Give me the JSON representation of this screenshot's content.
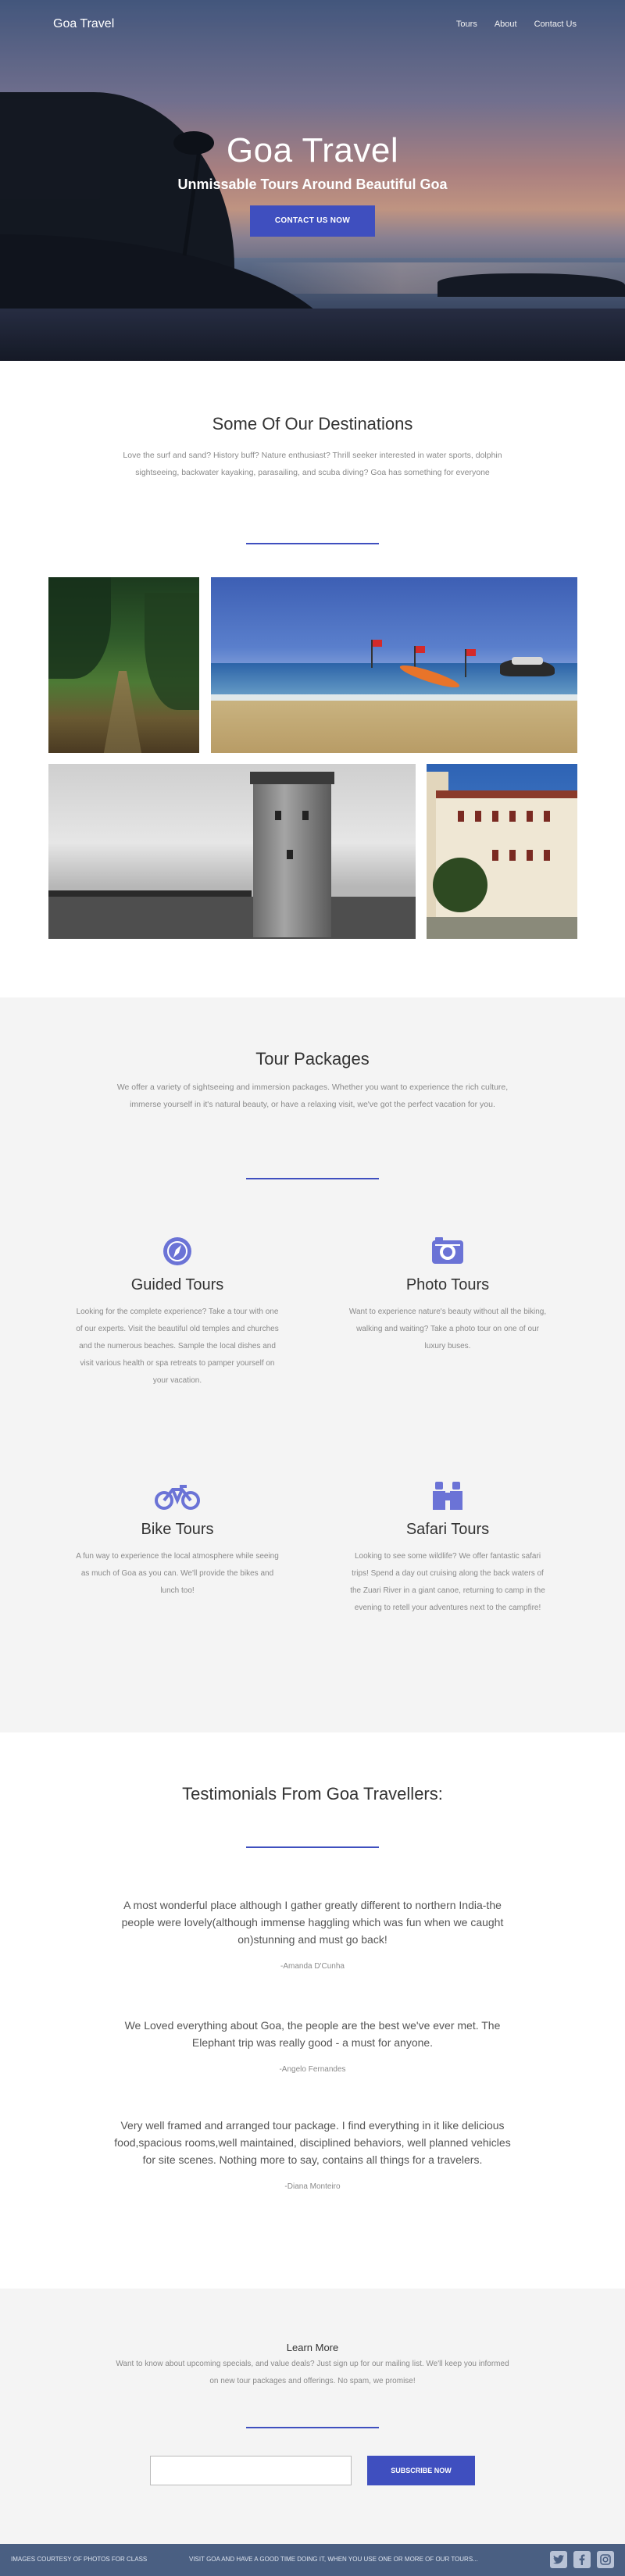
{
  "colors": {
    "accent": "#3f4fbf",
    "icon": "#6b73d6",
    "footer_bg": "#4a5f82",
    "section_alt_bg": "#f4f4f4"
  },
  "nav": {
    "brand": "Goa Travel",
    "links": [
      "Tours",
      "About",
      "Contact Us"
    ]
  },
  "hero": {
    "title": "Goa Travel",
    "subtitle": "Unmissable Tours Around Beautiful Goa",
    "cta": "CONTACT US NOW"
  },
  "destinations": {
    "title": "Some Of Our Destinations",
    "text": "Love the surf and sand? History buff? Nature enthusiast? Thrill seeker interested in water sports, dolphin sightseeing, backwater kayaking, parasailing, and scuba diving? Goa has something for everyone"
  },
  "packages": {
    "title": "Tour Packages",
    "text": "We offer a variety of sightseeing and immersion packages. Whether you want to experience the rich culture, immerse yourself in it's natural beauty, or have a relaxing visit, we've got the perfect vacation for you.",
    "tours": [
      {
        "icon": "compass-icon",
        "title": "Guided Tours",
        "text": "Looking for the complete experience? Take a tour with one of our experts. Visit the beautiful old temples and churches and the numerous beaches. Sample the local dishes and visit various health or spa retreats to pamper yourself on your vacation."
      },
      {
        "icon": "camera-icon",
        "title": "Photo Tours",
        "text": "Want to experience nature's beauty without all the biking, walking and waiting? Take a photo tour on one of our luxury buses."
      },
      {
        "icon": "bicycle-icon",
        "title": "Bike Tours",
        "text": "A fun way to experience the local atmosphere while seeing as much of Goa as you can. We'll provide the bikes and lunch too!"
      },
      {
        "icon": "binoculars-icon",
        "title": "Safari Tours",
        "text": "Looking to see some wildlife? We offer fantastic safari trips! Spend a day out cruising along the back waters of the Zuari River in a giant canoe, returning to camp in the evening to retell your adventures next to the campfire!"
      }
    ]
  },
  "testimonials": {
    "title": "Testimonials From Goa Travellers:",
    "items": [
      {
        "quote": "A most wonderful place although I gather greatly different to northern India-the people were lovely(although immense haggling which was fun when we caught on)stunning and must go back!",
        "author": "-Amanda D'Cunha"
      },
      {
        "quote": "We Loved everything about Goa, the people are the best we've ever met. The Elephant trip was really good - a must for anyone.",
        "author": "-Angelo Fernandes"
      },
      {
        "quote": "Very well framed and arranged tour package. I find everything in it like delicious food,spacious rooms,well maintained, disciplined behaviors, well planned vehicles for site scenes. Nothing more to say, contains all things for a travelers.",
        "author": "-Diana Monteiro"
      }
    ]
  },
  "learn": {
    "title": "Learn More",
    "text": "Want to know about upcoming specials, and value deals? Just sign up for our mailing list. We'll keep you informed on new tour packages and offerings. No spam, we promise!",
    "email_value": "",
    "subscribe": "SUBSCRIBE NOW"
  },
  "footer": {
    "left": "IMAGES COURTESY OF PHOTOS FOR CLASS",
    "middle": "VISIT GOA AND HAVE A GOOD TIME DOING IT, WHEN YOU USE ONE OR MORE OF OUR TOURS...",
    "social": [
      "twitter-icon",
      "facebook-icon",
      "instagram-icon"
    ]
  }
}
